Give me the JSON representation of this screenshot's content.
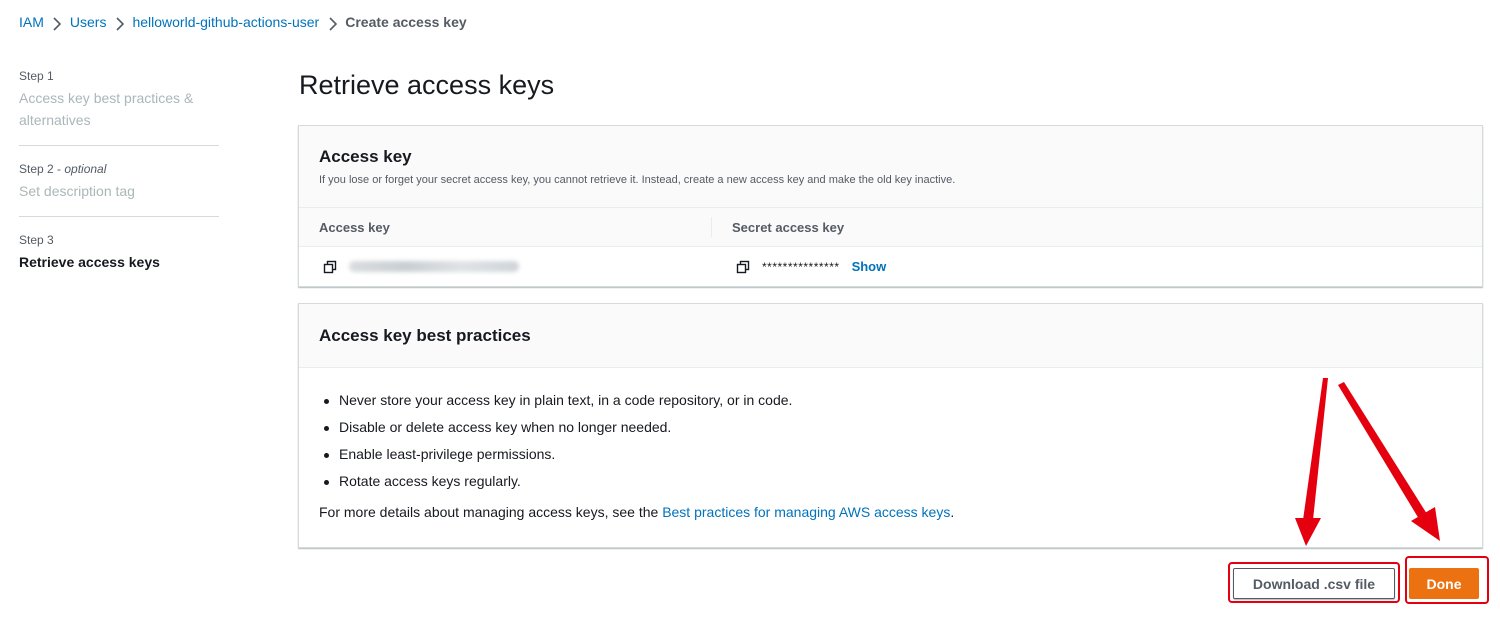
{
  "breadcrumb": {
    "items": [
      "IAM",
      "Users",
      "helloworld-github-actions-user"
    ],
    "current": "Create access key"
  },
  "steps": [
    {
      "number": "Step 1",
      "optional": "",
      "title": "Access key best practices & alternatives"
    },
    {
      "number": "Step 2 - ",
      "optional": "optional",
      "title": "Set description tag"
    },
    {
      "number": "Step 3",
      "optional": "",
      "title": "Retrieve access keys"
    }
  ],
  "page_title": "Retrieve access keys",
  "access_key_panel": {
    "title": "Access key",
    "description": "If you lose or forget your secret access key, you cannot retrieve it. Instead, create a new access key and make the old key inactive.",
    "col_access_key": "Access key",
    "col_secret_key": "Secret access key",
    "secret_masked": "***************",
    "show_label": "Show"
  },
  "best_practices_panel": {
    "title": "Access key best practices",
    "items": [
      "Never store your access key in plain text, in a code repository, or in code.",
      "Disable or delete access key when no longer needed.",
      "Enable least-privilege permissions.",
      "Rotate access keys regularly."
    ],
    "more_prefix": "For more details about managing access keys, see the ",
    "more_link": "Best practices for managing AWS access keys",
    "more_suffix": "."
  },
  "buttons": {
    "download": "Download .csv file",
    "done": "Done"
  },
  "colors": {
    "link": "#0073bb",
    "primary": "#ec7211",
    "annotation": "#e5000f"
  },
  "icons": [
    "chevron-right-icon",
    "copy-icon"
  ]
}
